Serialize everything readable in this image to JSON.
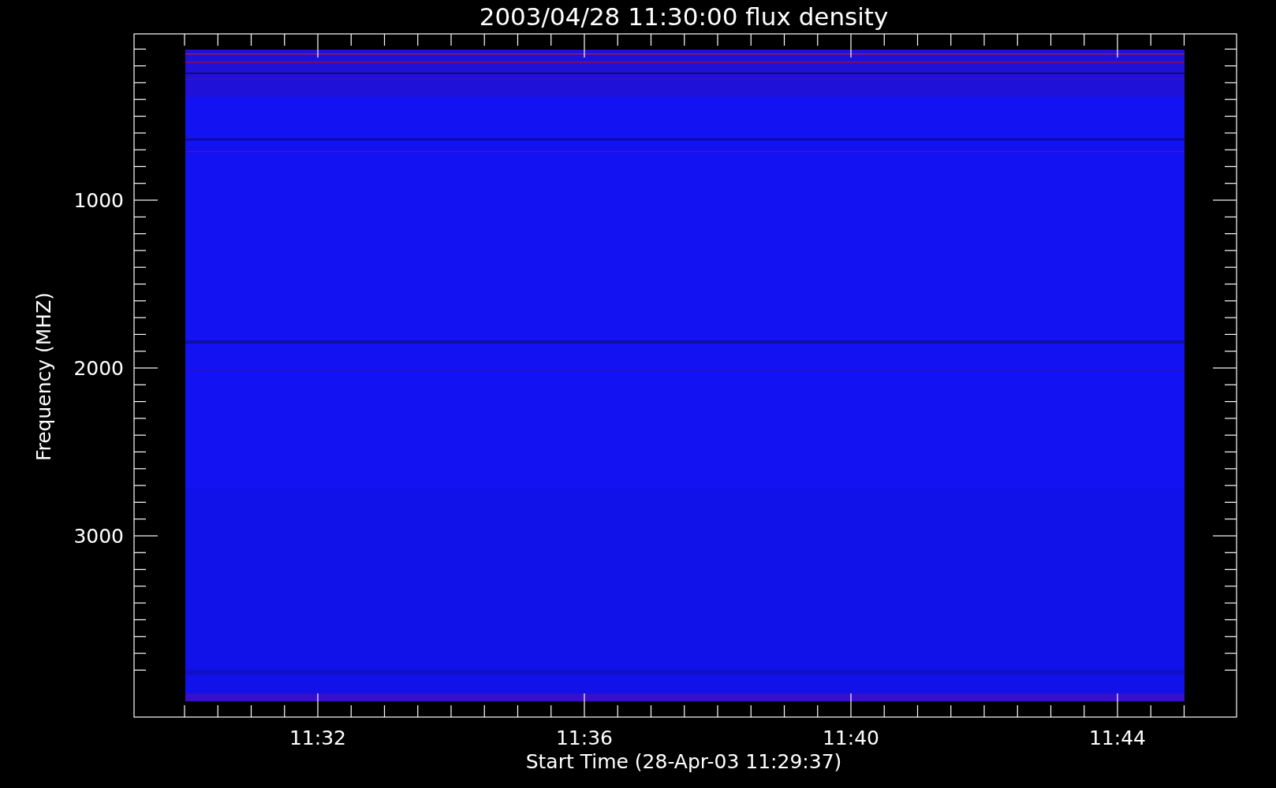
{
  "title": "2003/04/28 11:30:00 flux density",
  "y_axis": {
    "label": "Frequency (MHZ)",
    "ticks": [
      "1000",
      "2000",
      "3000"
    ]
  },
  "x_axis": {
    "label": "Start Time (28-Apr-03 11:29:37)",
    "ticks": [
      "11:32",
      "11:36",
      "11:40",
      "11:44"
    ]
  }
}
